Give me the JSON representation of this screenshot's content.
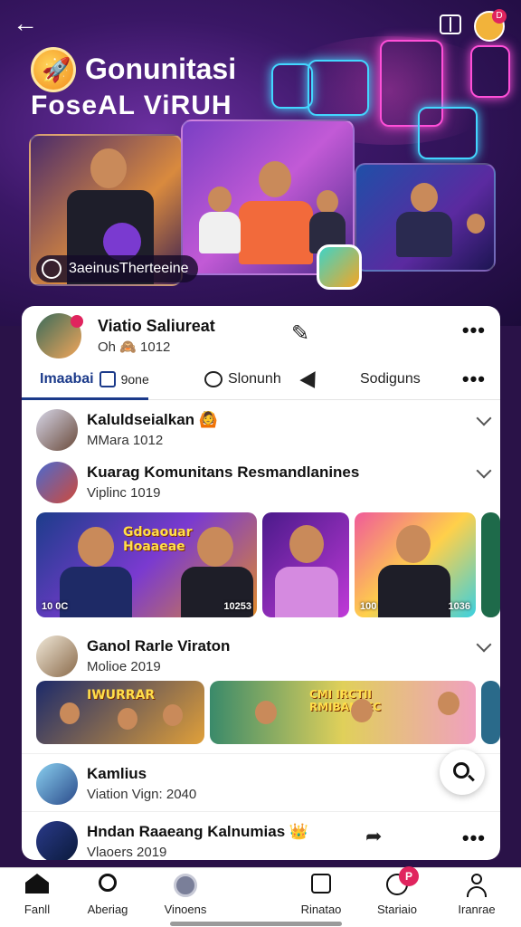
{
  "hero": {
    "title": "Gonunitasi",
    "subtitle": "FoseAL ViRUH",
    "caption": "3aeinusTherteeine"
  },
  "post": {
    "author": "Viatio Saliureat",
    "time": "Oh 🙈 1012",
    "tabs": [
      "Imaabai",
      "9one",
      "Slonunh",
      "Sodiguns"
    ]
  },
  "list": [
    {
      "name": "Kaluldseialkan 🙆",
      "sub": "MMara 1012"
    },
    {
      "name": "Kuarag Komunitans Resmandlanines",
      "sub": "Viplinc 1019"
    },
    {
      "name": "Ganol Rarle Viraton",
      "sub": "Molioe 2019"
    },
    {
      "name": "Kamlius",
      "sub": "Viation Vign: 2040"
    },
    {
      "name": "Hndan Raaeang Kalnumias 👑",
      "sub": "Vlaoers 2019"
    }
  ],
  "media_row1": [
    {
      "badge": "10 0C",
      "text": "Gdoaouar Hoaaeae"
    },
    {
      "badge": "10253",
      "text": ""
    },
    {
      "badge": "",
      "text": ""
    },
    {
      "badge": "100",
      "badge2": "1036",
      "text": ""
    }
  ],
  "media_row2": [
    {
      "text": "IWURRAR"
    },
    {
      "text": "CMI IRCTII RMIBANTEC"
    }
  ],
  "nav": [
    "Fanll",
    "Aberiag",
    "Vinoens",
    "Rinatao",
    "Stariaio",
    "Iranrae"
  ],
  "nav_badge": "P",
  "avatar_badge": "D"
}
